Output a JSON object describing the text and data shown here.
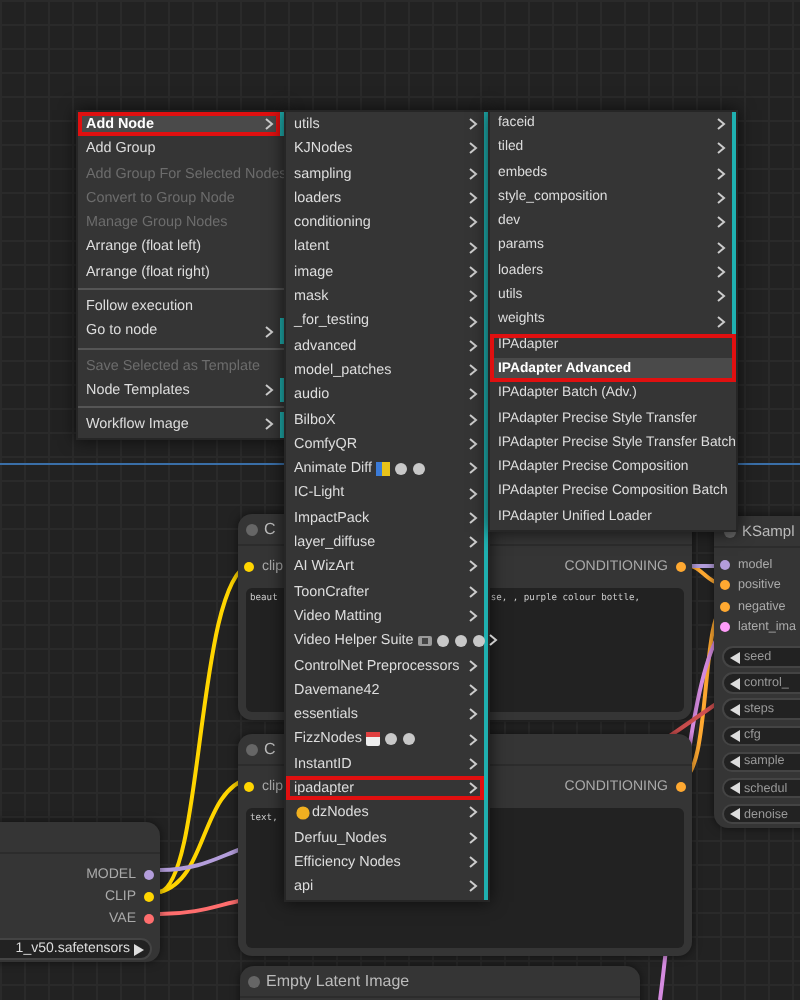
{
  "nodes": [
    {
      "kind": "text-encode",
      "title": "C",
      "inputs": [
        {
          "label": "clip",
          "color": "#ffd500"
        }
      ],
      "outputs": [
        {
          "label": "CONDITIONING",
          "color": "#ffa931"
        }
      ],
      "text_parts": [
        "beaut",
        "se, , purple colour bottle,"
      ]
    },
    {
      "kind": "text-encode",
      "title": "C",
      "inputs": [
        {
          "label": "clip",
          "color": "#ffd500"
        }
      ],
      "outputs": [
        {
          "label": "CONDITIONING",
          "color": "#ffa931"
        }
      ],
      "text_parts": [
        "text,"
      ]
    },
    {
      "kind": "sampler",
      "title": "KSampl",
      "inputs": [
        {
          "label": "model",
          "color": "#b39ddb"
        },
        {
          "label": "positive",
          "color": "#ffa931"
        },
        {
          "label": "negative",
          "color": "#ffa931"
        },
        {
          "label": "latent_ima",
          "color": "#ff9cf9"
        }
      ],
      "widgets": [
        {
          "kind": "number",
          "label": "seed"
        },
        {
          "kind": "number",
          "label": "control_"
        },
        {
          "kind": "number",
          "label": "steps"
        },
        {
          "kind": "number",
          "label": "cfg"
        },
        {
          "kind": "number",
          "label": "sample"
        },
        {
          "kind": "number",
          "label": "schedul"
        },
        {
          "kind": "number",
          "label": "denoise"
        }
      ]
    },
    {
      "kind": "checkpoint",
      "outputs": [
        {
          "label": "MODEL",
          "color": "#b39ddb"
        },
        {
          "label": "CLIP",
          "color": "#ffd500"
        },
        {
          "label": "VAE",
          "color": "#ff6e6e"
        }
      ],
      "widgets": [
        {
          "kind": "combo",
          "label": "1_v50.safetensors"
        }
      ]
    },
    {
      "kind": "latent",
      "title": "Empty Latent Image"
    }
  ],
  "menus": [
    {
      "groups": [
        [
          {
            "label": "Add Node",
            "submenu": true,
            "selected": true,
            "outlined": true,
            "disabled": false
          },
          {
            "label": "Add Group",
            "submenu": false,
            "selected": false,
            "outlined": false,
            "disabled": false
          },
          {
            "label": "Add Group For Selected Nodes",
            "submenu": false,
            "selected": false,
            "outlined": false,
            "disabled": true
          },
          {
            "label": "Convert to Group Node",
            "submenu": false,
            "selected": false,
            "outlined": false,
            "disabled": true
          },
          {
            "label": "Manage Group Nodes",
            "submenu": false,
            "selected": false,
            "outlined": false,
            "disabled": true
          },
          {
            "label": "Arrange (float left)",
            "submenu": false,
            "selected": false,
            "outlined": false,
            "disabled": false
          },
          {
            "label": "Arrange (float right)",
            "submenu": false,
            "selected": false,
            "outlined": false,
            "disabled": false
          }
        ],
        [
          {
            "label": "Follow execution",
            "submenu": false,
            "selected": false,
            "outlined": false,
            "disabled": false
          },
          {
            "label": "Go to node",
            "submenu": true,
            "selected": false,
            "outlined": false,
            "disabled": false
          }
        ],
        [
          {
            "label": "Save Selected as Template",
            "submenu": false,
            "selected": false,
            "outlined": false,
            "disabled": true
          },
          {
            "label": "Node Templates",
            "submenu": true,
            "selected": false,
            "outlined": false,
            "disabled": false
          }
        ],
        [
          {
            "label": "Workflow Image",
            "submenu": true,
            "selected": false,
            "outlined": false,
            "disabled": false
          }
        ]
      ]
    },
    {
      "groups": [
        [
          {
            "kind": "entry",
            "label": "utils",
            "submenu": true,
            "selected": false,
            "outlined": false
          },
          {
            "kind": "entry",
            "label": "KJNodes",
            "submenu": true,
            "selected": false,
            "outlined": false
          },
          {
            "kind": "entry",
            "label": "sampling",
            "submenu": true,
            "selected": false,
            "outlined": false
          },
          {
            "kind": "entry",
            "label": "loaders",
            "submenu": true,
            "selected": false,
            "outlined": false
          },
          {
            "kind": "entry",
            "label": "conditioning",
            "submenu": true,
            "selected": false,
            "outlined": false
          },
          {
            "kind": "entry",
            "label": "latent",
            "submenu": true,
            "selected": false,
            "outlined": false
          },
          {
            "kind": "entry",
            "label": "image",
            "submenu": true,
            "selected": false,
            "outlined": false
          },
          {
            "kind": "entry",
            "label": "mask",
            "submenu": true,
            "selected": false,
            "outlined": false
          },
          {
            "kind": "entry",
            "label": "_for_testing",
            "submenu": true,
            "selected": false,
            "outlined": false
          },
          {
            "kind": "entry",
            "label": "advanced",
            "submenu": true,
            "selected": false,
            "outlined": false
          },
          {
            "kind": "entry",
            "label": "model_patches",
            "submenu": true,
            "selected": false,
            "outlined": false
          },
          {
            "kind": "entry",
            "label": "audio",
            "submenu": true,
            "selected": false,
            "outlined": false
          },
          {
            "kind": "entry",
            "label": "BilboX",
            "submenu": true,
            "selected": false,
            "outlined": false
          },
          {
            "kind": "entry",
            "label": "ComfyQR",
            "submenu": true,
            "selected": false,
            "outlined": false
          },
          {
            "kind": "animate",
            "label": "Animate Diff",
            "submenu": true,
            "selected": false,
            "outlined": false
          },
          {
            "kind": "entry",
            "label": "IC-Light",
            "submenu": true,
            "selected": false,
            "outlined": false
          },
          {
            "kind": "entry",
            "label": "ImpactPack",
            "submenu": true,
            "selected": false,
            "outlined": false
          },
          {
            "kind": "entry",
            "label": "layer_diffuse",
            "submenu": true,
            "selected": false,
            "outlined": false
          },
          {
            "kind": "entry",
            "label": "AI WizArt",
            "submenu": true,
            "selected": false,
            "outlined": false
          },
          {
            "kind": "entry",
            "label": "ToonCrafter",
            "submenu": true,
            "selected": false,
            "outlined": false
          },
          {
            "kind": "entry",
            "label": "Video Matting",
            "submenu": true,
            "selected": false,
            "outlined": false
          },
          {
            "kind": "video",
            "label": "Video Helper Suite",
            "submenu": true,
            "selected": false,
            "outlined": false
          },
          {
            "kind": "entry",
            "label": "ControlNet Preprocessors",
            "submenu": true,
            "selected": false,
            "outlined": false
          },
          {
            "kind": "entry",
            "label": "Davemane42",
            "submenu": true,
            "selected": false,
            "outlined": false
          },
          {
            "kind": "entry",
            "label": "essentials",
            "submenu": true,
            "selected": false,
            "outlined": false
          },
          {
            "kind": "fizz",
            "label": "FizzNodes",
            "submenu": true,
            "selected": false,
            "outlined": false
          },
          {
            "kind": "entry",
            "label": "InstantID",
            "submenu": true,
            "selected": false,
            "outlined": false
          },
          {
            "kind": "entry",
            "label": "ipadapter",
            "submenu": true,
            "selected": false,
            "outlined": true
          },
          {
            "kind": "koala",
            "label": "dzNodes",
            "submenu": true,
            "selected": false,
            "outlined": false
          },
          {
            "kind": "entry",
            "label": "Derfuu_Nodes",
            "submenu": true,
            "selected": false,
            "outlined": false
          },
          {
            "kind": "entry",
            "label": "Efficiency Nodes",
            "submenu": true,
            "selected": false,
            "outlined": false
          },
          {
            "kind": "entry",
            "label": "api",
            "submenu": true,
            "selected": false,
            "outlined": false
          }
        ]
      ]
    },
    {
      "groups": [
        [
          {
            "label": "faceid",
            "submenu": true,
            "selected": false,
            "outlined": false
          },
          {
            "label": "tiled",
            "submenu": true,
            "selected": false,
            "outlined": false
          },
          {
            "label": "embeds",
            "submenu": true,
            "selected": false,
            "outlined": false
          },
          {
            "label": "style_composition",
            "submenu": true,
            "selected": false,
            "outlined": false
          },
          {
            "label": "dev",
            "submenu": true,
            "selected": false,
            "outlined": false
          },
          {
            "label": "params",
            "submenu": true,
            "selected": false,
            "outlined": false
          },
          {
            "label": "loaders",
            "submenu": true,
            "selected": false,
            "outlined": false
          },
          {
            "label": "utils",
            "submenu": true,
            "selected": false,
            "outlined": false
          },
          {
            "label": "weights",
            "submenu": true,
            "selected": false,
            "outlined": false
          },
          {
            "label": "IPAdapter",
            "submenu": false,
            "selected": false,
            "outlined": true
          },
          {
            "label": "IPAdapter Advanced",
            "submenu": false,
            "selected": true,
            "outlined": true
          },
          {
            "label": "IPAdapter Batch (Adv.)",
            "submenu": false,
            "selected": false,
            "outlined": false
          },
          {
            "label": "IPAdapter Precise Style Transfer",
            "submenu": false,
            "selected": false,
            "outlined": false
          },
          {
            "label": "IPAdapter Precise Style Transfer Batch",
            "submenu": false,
            "selected": false,
            "outlined": false
          },
          {
            "label": "IPAdapter Precise Composition",
            "submenu": false,
            "selected": false,
            "outlined": false
          },
          {
            "label": "IPAdapter Precise Composition Batch",
            "submenu": false,
            "selected": false,
            "outlined": false
          },
          {
            "label": "IPAdapter Unified Loader",
            "submenu": false,
            "selected": false,
            "outlined": false
          }
        ]
      ]
    }
  ]
}
